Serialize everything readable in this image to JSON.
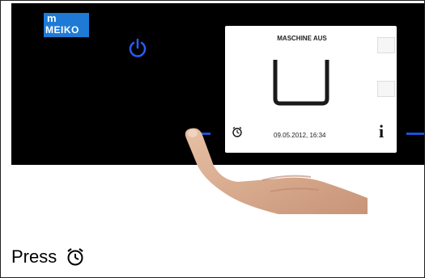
{
  "logo": {
    "line1": "m",
    "line2": "MEIKO"
  },
  "screen": {
    "title": "MASCHINE AUS",
    "datetime": "09.05.2012, 16:34",
    "info_symbol": "i"
  },
  "icons": {
    "power": "power-icon",
    "timer": "alarm-clock-icon",
    "info": "info-icon",
    "hand": "pointing-hand"
  },
  "instruction": {
    "text": "Press",
    "icon": "alarm-clock-icon"
  },
  "colors": {
    "panel": "#000000",
    "accent_blue": "#1f4ed6",
    "logo_blue": "#1f7ad6"
  }
}
